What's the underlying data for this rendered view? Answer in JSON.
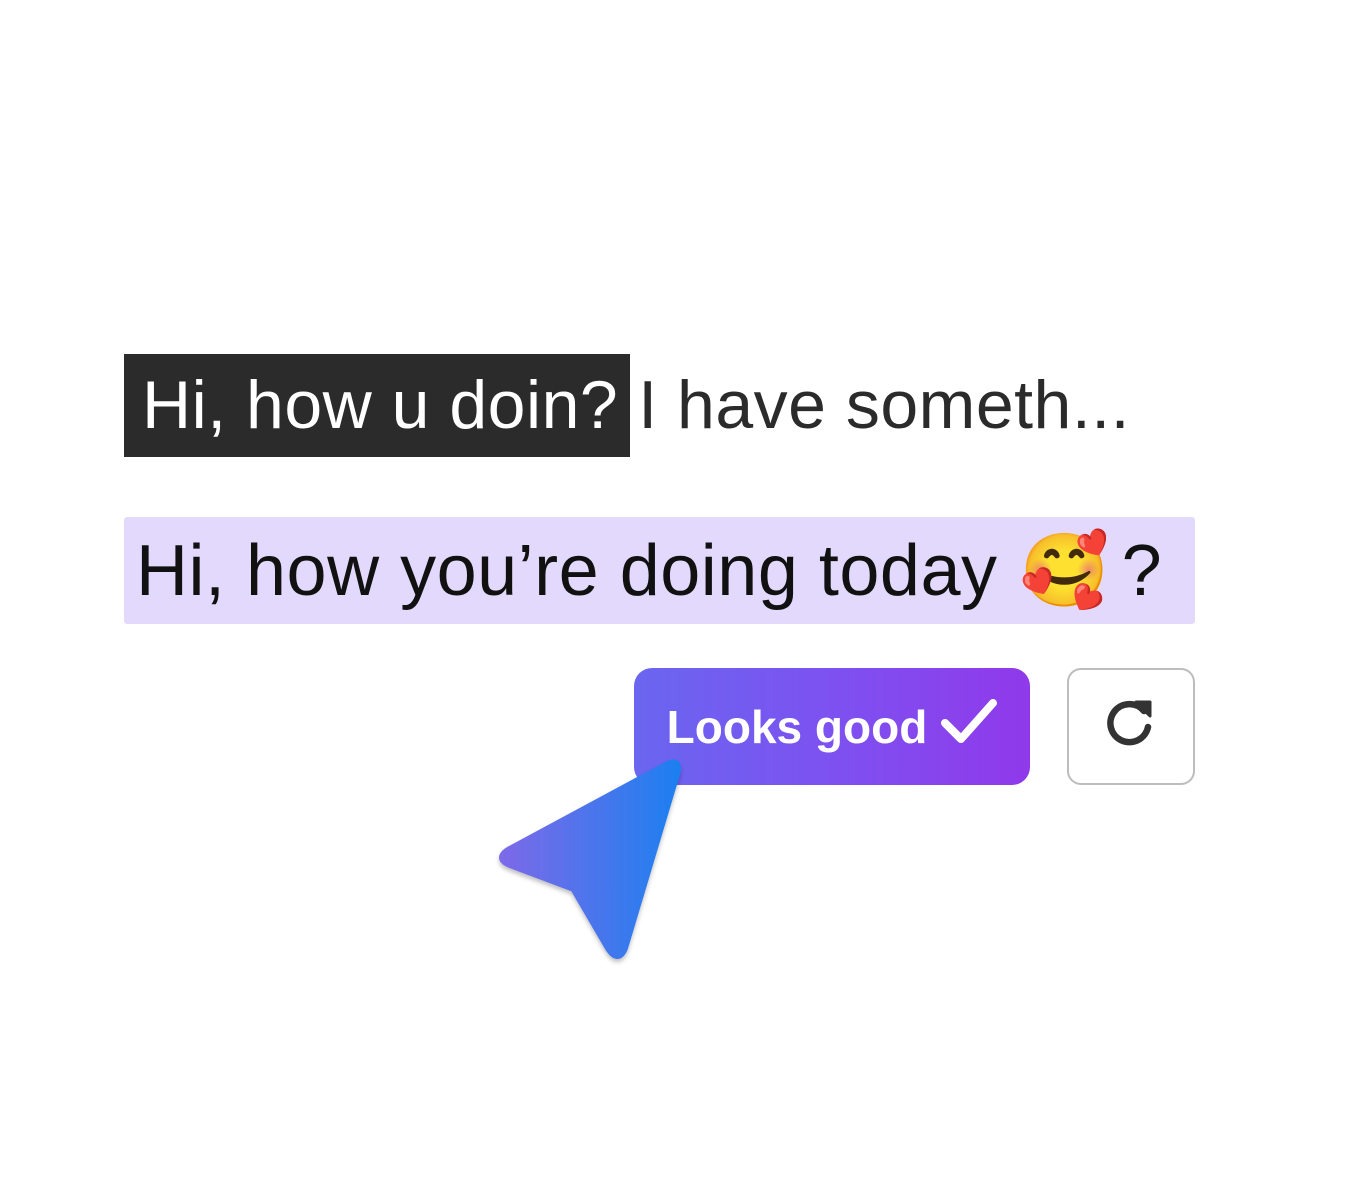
{
  "editor": {
    "selected_text": "Hi, how u doin?",
    "remaining_text": "I have someth..."
  },
  "suggestion": {
    "text": "Hi, how you’re doing today",
    "emoji": "🥰",
    "trailing": "?"
  },
  "actions": {
    "accept_label": "Looks good",
    "accept_icon": "checkmark-icon",
    "regenerate_icon": "refresh-icon"
  },
  "colors": {
    "selection_bg": "#2b2b2b",
    "suggestion_bg": "#e3d9fc",
    "button_gradient_start": "#6a66f0",
    "button_gradient_end": "#9039ea",
    "cursor_gradient_start": "#7b6ae8",
    "cursor_gradient_end": "#1e7ff0"
  }
}
